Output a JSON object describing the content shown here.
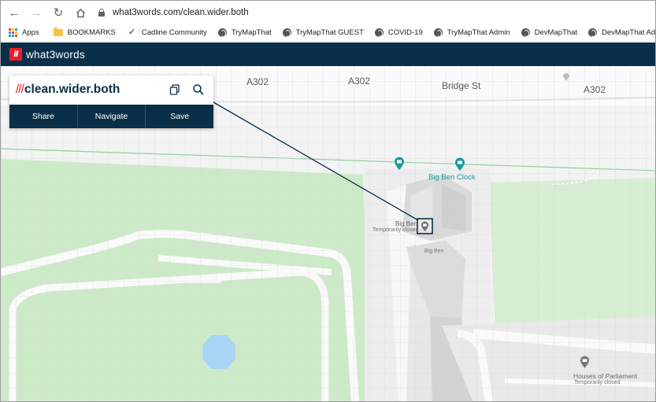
{
  "browser": {
    "url": "what3words.com/clean.wider.both",
    "bookmarks": [
      {
        "label": "Apps",
        "icon": "apps-grid-icon"
      },
      {
        "label": "BOOKMARKS",
        "icon": "folder-icon"
      },
      {
        "label": "Cadline Community",
        "icon": "cadline-icon"
      },
      {
        "label": "TryMapThat",
        "icon": "globe-icon"
      },
      {
        "label": "TryMapThat GUEST",
        "icon": "globe-icon"
      },
      {
        "label": "COVID-19",
        "icon": "globe-icon"
      },
      {
        "label": "TryMapThat Admin",
        "icon": "globe-icon"
      },
      {
        "label": "DevMapThat",
        "icon": "globe-icon"
      },
      {
        "label": "DevMapThat Admin",
        "icon": "globe-icon"
      }
    ]
  },
  "site": {
    "logo_mark": "///",
    "logo_text": "what3words",
    "brand_color": "#0a3049",
    "accent_color": "#e11f26"
  },
  "card": {
    "slashes": "///",
    "address": "clean.wider.both",
    "actions": {
      "share": "Share",
      "navigate": "Navigate",
      "save": "Save"
    }
  },
  "map": {
    "roads": [
      "A302",
      "A302",
      "Bridge St",
      "A302"
    ],
    "pois": {
      "big_ben_clock": "Big Ben Clock",
      "big_ben": "Big Ben",
      "big_ben_status": "Temporarily closed",
      "big_ben_small": "Big Ben",
      "houses_of_parliament": "Houses of Parliament",
      "hop_status": "Temporarily closed"
    }
  }
}
